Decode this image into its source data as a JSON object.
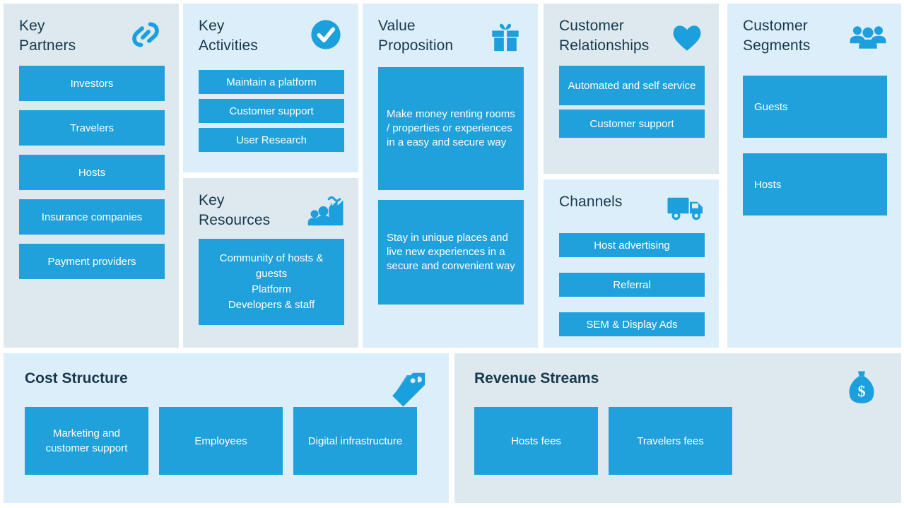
{
  "diagram": {
    "type": "business-model-canvas",
    "colors": {
      "card_blue": "#21a1db",
      "panel_tint_a": "#dde8ef",
      "panel_tint_b": "#ddeefb",
      "heading_text": "#17394c",
      "card_text": "#ffffff",
      "page_background": "#ffffff"
    }
  },
  "blocks": {
    "key_partners": {
      "title": "Key\nPartners",
      "icon": "link-chain-icon",
      "cards": [
        "Investors",
        "Travelers",
        "Hosts",
        "Insurance companies",
        "Payment providers"
      ]
    },
    "key_activities": {
      "title": "Key\nActivities",
      "icon": "check-circle-icon",
      "cards": [
        "Maintain a platform",
        "Customer support",
        "User Research"
      ]
    },
    "key_resources": {
      "title": "Key\nResources",
      "icon": "factory-people-icon",
      "cards": [
        "Community of hosts &\nguests\nPlatform\nDevelopers & staff"
      ]
    },
    "value_proposition": {
      "title": "Value\nProposition",
      "icon": "gift-box-icon",
      "cards": [
        "Make money renting rooms / properties or experiences in a easy and secure way",
        "Stay in unique places and live new experiences in a secure and convenient way"
      ]
    },
    "customer_relationships": {
      "title": "Customer\nRelationships",
      "icon": "heart-icon",
      "cards": [
        "Automated and self service",
        "Customer support"
      ]
    },
    "channels": {
      "title": "Channels",
      "icon": "delivery-truck-icon",
      "cards": [
        "Host advertising",
        "Referral",
        "SEM & Display Ads"
      ]
    },
    "customer_segments": {
      "title": "Customer\nSegments",
      "icon": "people-group-icon",
      "cards": [
        "Guests",
        "Hosts"
      ]
    },
    "cost_structure": {
      "title": "Cost Structure",
      "icon": "price-tag-icon",
      "cards": [
        "Marketing and customer support",
        "Employees",
        "Digital infrastructure"
      ]
    },
    "revenue_streams": {
      "title": "Revenue Streams",
      "icon": "money-bag-icon",
      "cards": [
        "Hosts fees",
        "Travelers fees"
      ]
    }
  }
}
